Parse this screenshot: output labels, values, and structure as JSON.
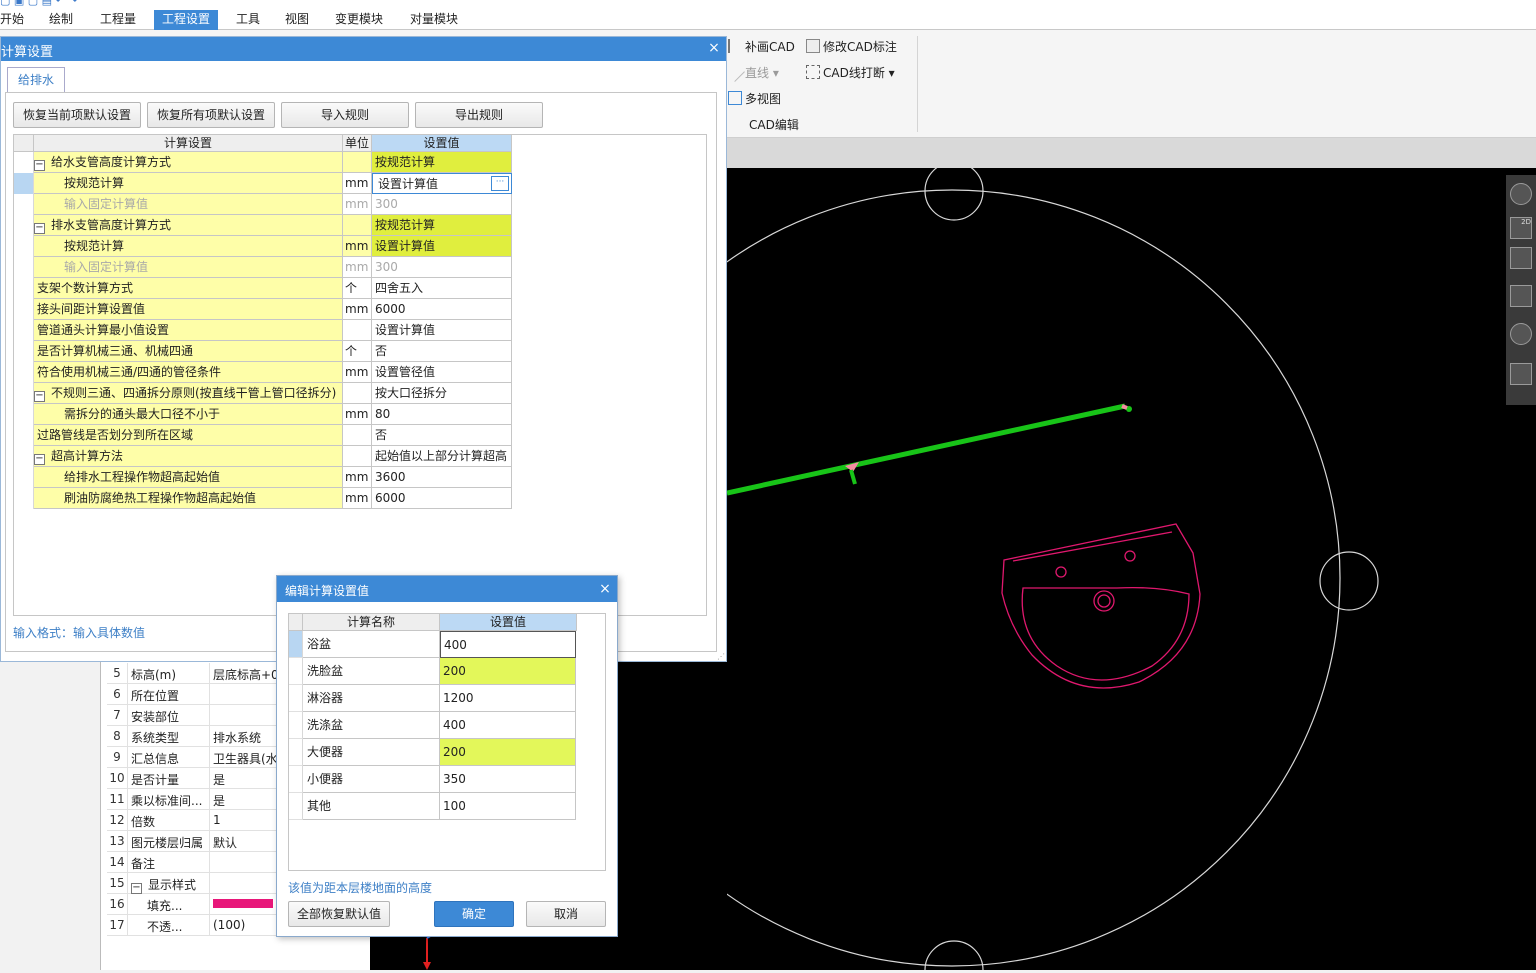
{
  "menu": {
    "items": [
      {
        "label": "开始"
      },
      {
        "label": "绘制"
      },
      {
        "label": "工程量"
      },
      {
        "label": "工程设置"
      },
      {
        "label": "工具"
      },
      {
        "label": "视图"
      },
      {
        "label": "变更模块"
      },
      {
        "label": "对量模块"
      }
    ],
    "active_index": 3
  },
  "ribbon": {
    "buchua_cad": "补画CAD",
    "modify_cad_label": "修改CAD标注",
    "line": "直线",
    "cad_line_break": "CAD线打断",
    "multi_view": "多视图",
    "group_label": "CAD编辑"
  },
  "view_tools": {
    "label_2d": "2D"
  },
  "main_dialog": {
    "title": "计算设置",
    "close": "×",
    "tab": "给排水",
    "buttons": {
      "restore_current": "恢复当前项默认设置",
      "restore_all": "恢复所有项默认设置",
      "import": "导入规则",
      "export": "导出规则"
    },
    "headers": {
      "name": "计算设置",
      "unit": "单位",
      "value": "设置值"
    },
    "rows": [
      {
        "name": "给水支管高度计算方式",
        "unit": "",
        "value": "按规范计算"
      },
      {
        "name": "按规范计算",
        "unit": "mm",
        "value": "设置计算值"
      },
      {
        "name": "输入固定计算值",
        "unit": "mm",
        "value": "300"
      },
      {
        "name": "排水支管高度计算方式",
        "unit": "",
        "value": "按规范计算"
      },
      {
        "name": "按规范计算",
        "unit": "mm",
        "value": "设置计算值"
      },
      {
        "name": "输入固定计算值",
        "unit": "mm",
        "value": "300"
      },
      {
        "name": "支架个数计算方式",
        "unit": "个",
        "value": "四舍五入"
      },
      {
        "name": "接头间距计算设置值",
        "unit": "mm",
        "value": "6000"
      },
      {
        "name": "管道通头计算最小值设置",
        "unit": "",
        "value": "设置计算值"
      },
      {
        "name": "是否计算机械三通、机械四通",
        "unit": "个",
        "value": "否"
      },
      {
        "name": "符合使用机械三通/四通的管径条件",
        "unit": "mm",
        "value": "设置管径值"
      },
      {
        "name": "不规则三通、四通拆分原则(按直线干管上管口径拆分)",
        "unit": "",
        "value": "按大口径拆分"
      },
      {
        "name": "需拆分的通头最大口径不小于",
        "unit": "mm",
        "value": "80"
      },
      {
        "name": "过路管线是否划分到所在区域",
        "unit": "",
        "value": "否"
      },
      {
        "name": "超高计算方法",
        "unit": "",
        "value": "起始值以上部分计算超高"
      },
      {
        "name": "给排水工程操作物超高起始值",
        "unit": "mm",
        "value": "3600"
      },
      {
        "name": "刷油防腐绝热工程操作物超高起始值",
        "unit": "mm",
        "value": "6000"
      }
    ],
    "hint": "输入格式：输入具体数值",
    "edit_button": "···"
  },
  "sub_dialog": {
    "title": "编辑计算设置值",
    "close": "×",
    "headers": {
      "name": "计算名称",
      "value": "设置值"
    },
    "rows": [
      {
        "name": "浴盆",
        "value": "400"
      },
      {
        "name": "洗脸盆",
        "value": "200"
      },
      {
        "name": "淋浴器",
        "value": "1200"
      },
      {
        "name": "洗涤盆",
        "value": "400"
      },
      {
        "name": "大便器",
        "value": "200"
      },
      {
        "name": "小便器",
        "value": "350"
      },
      {
        "name": "其他",
        "value": "100"
      }
    ],
    "hint": "该值为距本层楼地面的高度",
    "buttons": {
      "restore_all": "全部恢复默认值",
      "ok": "确定",
      "cancel": "取消"
    }
  },
  "properties": {
    "rows": [
      {
        "num": "5",
        "key": "标高(m)",
        "value": "层底标高+0"
      },
      {
        "num": "6",
        "key": "所在位置",
        "value": ""
      },
      {
        "num": "7",
        "key": "安装部位",
        "value": ""
      },
      {
        "num": "8",
        "key": "系统类型",
        "value": "排水系统"
      },
      {
        "num": "9",
        "key": "汇总信息",
        "value": "卫生器具(水"
      },
      {
        "num": "10",
        "key": "是否计量",
        "value": "是"
      },
      {
        "num": "11",
        "key": "乘以标准间...",
        "value": "是"
      },
      {
        "num": "12",
        "key": "倍数",
        "value": "1"
      },
      {
        "num": "13",
        "key": "图元楼层归属",
        "value": "默认"
      },
      {
        "num": "14",
        "key": "备注",
        "value": ""
      },
      {
        "num": "15",
        "key": "显示样式",
        "value": ""
      },
      {
        "num": "16",
        "key": "填充...",
        "value": ""
      },
      {
        "num": "17",
        "key": "不透...",
        "value": "(100)"
      }
    ]
  },
  "colors": {
    "accent": "#3d89d6",
    "highlight_yellow": "#fefea8",
    "highlight_lime": "#e0ee3e",
    "pipe_green": "#18c418",
    "basin_magenta": "#e0186e",
    "fill_swatch": "#e8177a"
  }
}
